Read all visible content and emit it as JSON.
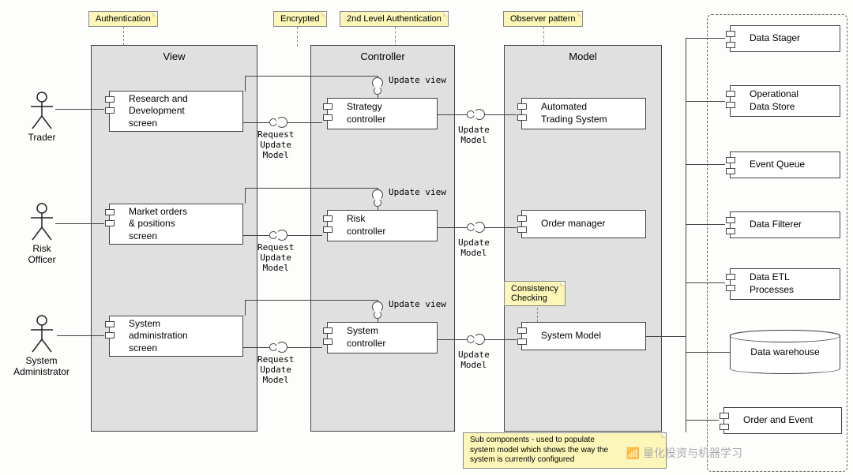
{
  "notes": {
    "authentication": "Authentication",
    "encrypted": "Encrypted",
    "second_auth": "2nd Level Authentication",
    "observer": "Observer pattern",
    "consistency": "Consistency\nChecking",
    "subcomponents": "Sub components - used to populate\nsystem model which shows the way the\nsystem is currently configured"
  },
  "packages": {
    "view": "View",
    "controller": "Controller",
    "model": "Model"
  },
  "actors": {
    "trader": "Trader",
    "risk_officer": "Risk\nOfficer",
    "sys_admin": "System\nAdministrator"
  },
  "components": {
    "view": {
      "rd": "Research and\nDevelopment\nscreen",
      "mop": "Market orders\n& positions\nscreen",
      "sysadmin": "System\nadministration\nscreen"
    },
    "controller": {
      "strategy": "Strategy\ncontroller",
      "risk": "Risk\ncontroller",
      "system": "System\ncontroller"
    },
    "model": {
      "ats": "Automated\nTrading System",
      "order_mgr": "Order manager",
      "sys_model": "System Model"
    },
    "right": {
      "data_stager": "Data Stager",
      "ods": "Operational\nData Store",
      "event_queue": "Event Queue",
      "data_filterer": "Data Filterer",
      "etl": "Data ETL\nProcesses",
      "warehouse": "Data warehouse",
      "order_event": "Order and Event"
    }
  },
  "labels": {
    "request_update": "Request\nUpdate\nModel",
    "update_view": "Update view",
    "update_model": "Update\nModel"
  },
  "watermark": "量化投资与机器学习"
}
